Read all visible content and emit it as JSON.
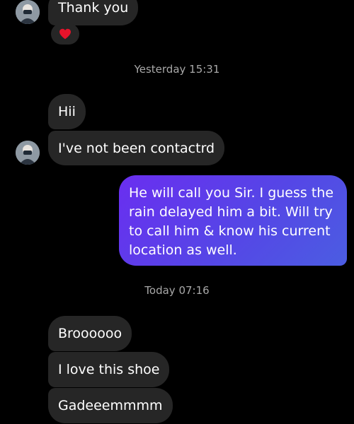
{
  "conversation": {
    "messages_top": {
      "thank_you": "Thank you",
      "reaction": "heart"
    },
    "timestamps": {
      "yesterday": "Yesterday 15:31",
      "today": "Today 07:16"
    },
    "received_group_1": [
      "Hii",
      "I've not been contactrd"
    ],
    "sent": "He will call you Sir. I guess the rain delayed him a bit. Will try to call him & know his current location as well.",
    "received_group_2": [
      "Brooooo​o",
      "I love this shoe",
      "Gadeeemmmm"
    ]
  },
  "colors": {
    "background": "#000000",
    "received_bubble": "#262626",
    "sent_gradient_start": "#6a2ef0",
    "sent_gradient_end": "#4b5de2",
    "timestamp_text": "#a8a8a8",
    "heart": "#e8132b"
  },
  "icons": {
    "contact_avatar": "avatar-icon",
    "reaction": "heart-icon"
  }
}
